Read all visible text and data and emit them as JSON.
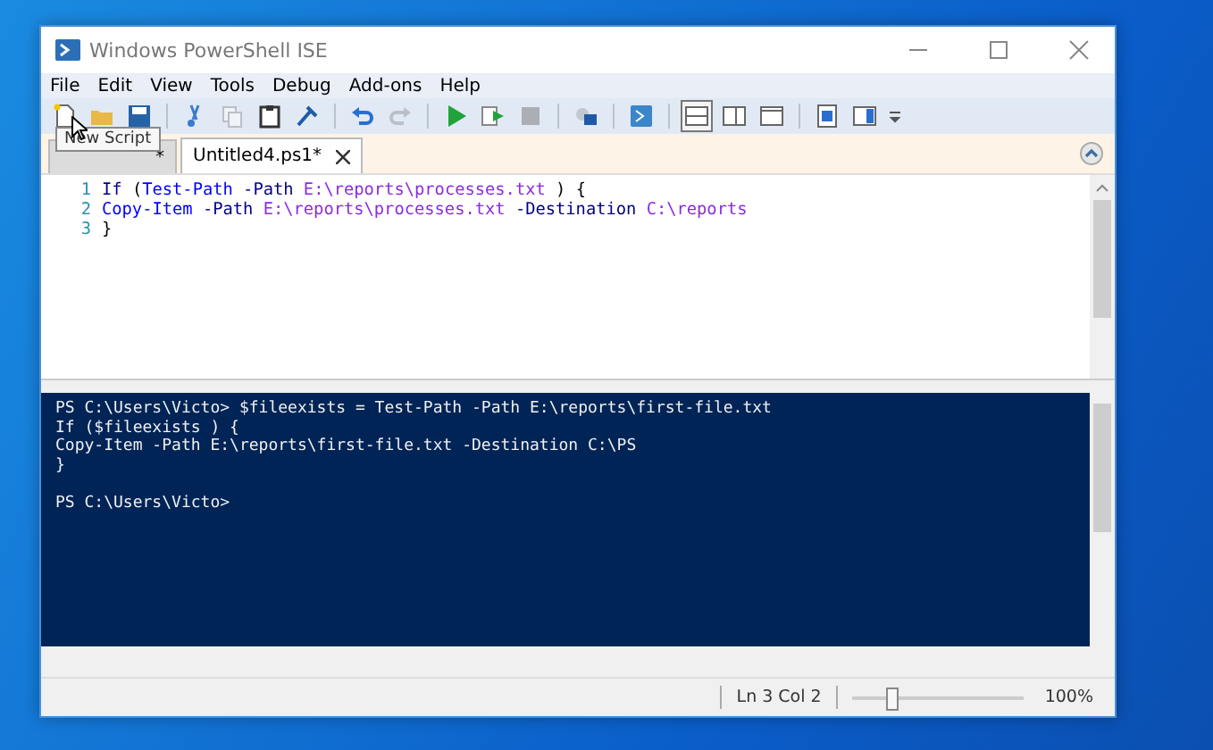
{
  "window": {
    "title": "Windows PowerShell ISE"
  },
  "menu": [
    "File",
    "Edit",
    "View",
    "Tools",
    "Debug",
    "Add-ons",
    "Help"
  ],
  "toolbar": [
    {
      "kind": "new",
      "disabled": false,
      "selected": false
    },
    {
      "kind": "open",
      "disabled": false,
      "selected": false
    },
    {
      "kind": "save",
      "disabled": false,
      "selected": false
    },
    {
      "kind": "sep"
    },
    {
      "kind": "cut",
      "disabled": false,
      "selected": false
    },
    {
      "kind": "copy",
      "disabled": true,
      "selected": false
    },
    {
      "kind": "paste",
      "disabled": false,
      "selected": false
    },
    {
      "kind": "clear",
      "disabled": false,
      "selected": false
    },
    {
      "kind": "sep"
    },
    {
      "kind": "undo",
      "disabled": false,
      "selected": false
    },
    {
      "kind": "redo",
      "disabled": true,
      "selected": false
    },
    {
      "kind": "sep"
    },
    {
      "kind": "run",
      "disabled": false,
      "selected": false
    },
    {
      "kind": "runsel",
      "disabled": false,
      "selected": false
    },
    {
      "kind": "stop",
      "disabled": true,
      "selected": false
    },
    {
      "kind": "sep"
    },
    {
      "kind": "remote",
      "disabled": false,
      "selected": false
    },
    {
      "kind": "sep"
    },
    {
      "kind": "console",
      "disabled": false,
      "selected": false
    },
    {
      "kind": "sep"
    },
    {
      "kind": "panetop",
      "disabled": false,
      "selected": true
    },
    {
      "kind": "paneright",
      "disabled": false,
      "selected": false
    },
    {
      "kind": "panemax",
      "disabled": false,
      "selected": false
    },
    {
      "kind": "sep"
    },
    {
      "kind": "showcmd",
      "disabled": false,
      "selected": false
    },
    {
      "kind": "addon",
      "disabled": false,
      "selected": false
    }
  ],
  "tooltip": "New Script",
  "tabs": [
    {
      "label": "*",
      "selected": false
    },
    {
      "label": "Untitled4.ps1*",
      "selected": true
    }
  ],
  "editor": {
    "lines": [
      {
        "number": "1",
        "tokens": [
          {
            "kind": "keyword",
            "text": "If"
          },
          {
            "kind": "plain",
            "text": " ("
          },
          {
            "kind": "command",
            "text": "Test-Path"
          },
          {
            "kind": "parameter",
            "text": " -Path"
          },
          {
            "kind": "argument",
            "text": " E:\\reports\\processes.txt"
          },
          {
            "kind": "plain",
            "text": " ) {"
          }
        ]
      },
      {
        "number": "2",
        "tokens": [
          {
            "kind": "command",
            "text": "Copy-Item"
          },
          {
            "kind": "parameter",
            "text": " -Path"
          },
          {
            "kind": "argument",
            "text": " E:\\reports\\processes.txt"
          },
          {
            "kind": "parameter",
            "text": " -Destination"
          },
          {
            "kind": "argument",
            "text": " C:\\reports"
          }
        ]
      },
      {
        "number": "3",
        "tokens": [
          {
            "kind": "plain",
            "text": "}"
          }
        ]
      }
    ]
  },
  "console": {
    "blocks": [
      [
        "PS C:\\Users\\Victo> $fileexists = Test-Path -Path E:\\reports\\first-file.txt",
        "If ($fileexists ) {",
        "Copy-Item -Path E:\\reports\\first-file.txt -Destination C:\\PS",
        "}"
      ],
      [
        "PS C:\\Users\\Victo>"
      ]
    ]
  },
  "status_bar": {
    "position": "Ln 3  Col 2",
    "zoom": {
      "level": 0.23
    },
    "zoom_text": "100%"
  }
}
